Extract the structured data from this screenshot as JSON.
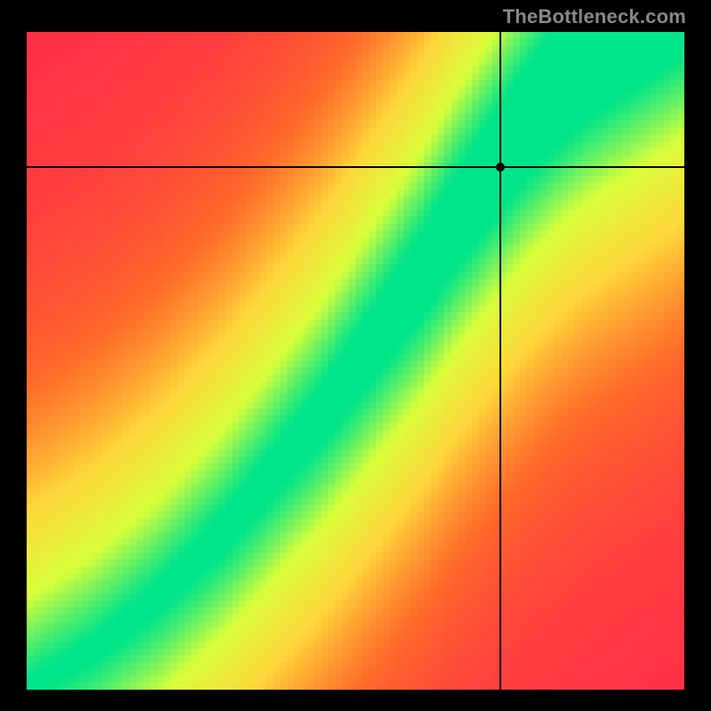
{
  "attribution": "TheBottleneck.com",
  "plot": {
    "crosshair": {
      "x_frac": 0.72,
      "y_frac": 0.205
    }
  },
  "chart_data": {
    "type": "heatmap",
    "title": "",
    "xlabel": "",
    "ylabel": "",
    "xlim": [
      0,
      1
    ],
    "ylim": [
      0,
      1
    ],
    "grid": false,
    "legend": false,
    "resolution": 96,
    "colormap": [
      {
        "t": 0.0,
        "color": "#ff2a4a"
      },
      {
        "t": 0.25,
        "color": "#ff6a2a"
      },
      {
        "t": 0.5,
        "color": "#ffd83a"
      },
      {
        "t": 0.75,
        "color": "#d8ff3a"
      },
      {
        "t": 1.0,
        "color": "#00e58a"
      }
    ],
    "ridge": {
      "description": "optimal-balance curve (green ridge) as y(x) sampled x in [0,1], y in [0,1] with origin bottom-left",
      "points": [
        [
          0.0,
          0.0
        ],
        [
          0.05,
          0.03
        ],
        [
          0.1,
          0.06
        ],
        [
          0.15,
          0.1
        ],
        [
          0.2,
          0.14
        ],
        [
          0.25,
          0.19
        ],
        [
          0.3,
          0.24
        ],
        [
          0.35,
          0.3
        ],
        [
          0.4,
          0.36
        ],
        [
          0.45,
          0.42
        ],
        [
          0.5,
          0.49
        ],
        [
          0.55,
          0.56
        ],
        [
          0.6,
          0.63
        ],
        [
          0.65,
          0.71
        ],
        [
          0.7,
          0.78
        ],
        [
          0.75,
          0.85
        ],
        [
          0.8,
          0.91
        ],
        [
          0.85,
          0.96
        ],
        [
          0.9,
          1.0
        ]
      ],
      "width_at_x": [
        [
          0.0,
          0.01
        ],
        [
          0.2,
          0.02
        ],
        [
          0.4,
          0.035
        ],
        [
          0.6,
          0.06
        ],
        [
          0.8,
          0.085
        ],
        [
          1.0,
          0.11
        ]
      ]
    },
    "marker": {
      "x": 0.72,
      "y": 0.795
    }
  }
}
